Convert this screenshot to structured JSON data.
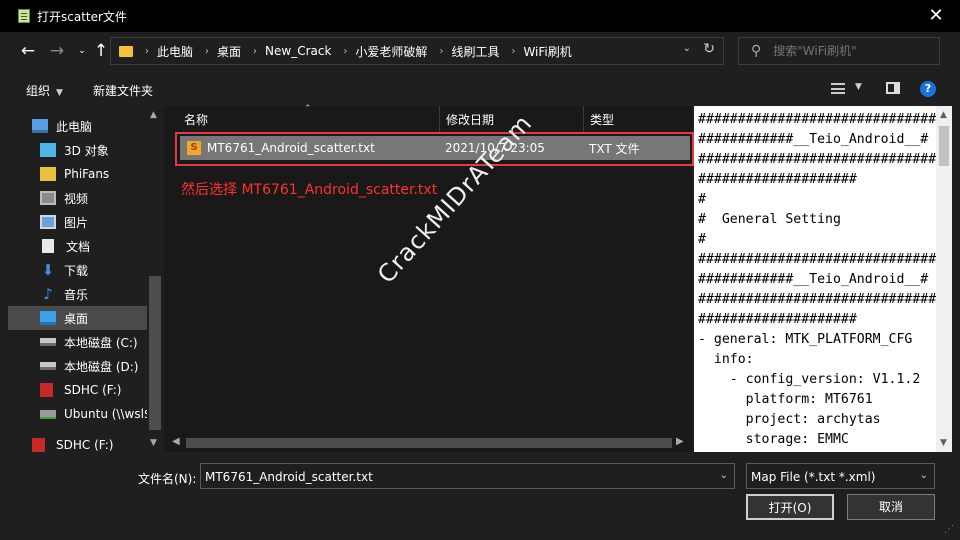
{
  "window": {
    "title": "打开scatter文件"
  },
  "nav": {
    "breadcrumbs": [
      "此电脑",
      "桌面",
      "New_Crack",
      "小爱老师破解",
      "线刷工具",
      "WiFi刷机"
    ],
    "search_placeholder": "搜索\"WiFi刷机\""
  },
  "toolbar": {
    "organize": "组织",
    "new_folder": "新建文件夹"
  },
  "sidebar": {
    "items": [
      {
        "label": "此电脑",
        "icon": "pc-icon"
      },
      {
        "label": "3D 对象",
        "icon": "3d-objects-icon"
      },
      {
        "label": "PhiFans",
        "icon": "phifans-icon"
      },
      {
        "label": "视频",
        "icon": "video-icon"
      },
      {
        "label": "图片",
        "icon": "pictures-icon"
      },
      {
        "label": "文档",
        "icon": "documents-icon"
      },
      {
        "label": "下载",
        "icon": "download-icon"
      },
      {
        "label": "音乐",
        "icon": "music-icon"
      },
      {
        "label": "桌面",
        "icon": "desktop-icon",
        "selected": true
      },
      {
        "label": "本地磁盘 (C:)",
        "icon": "drive-icon"
      },
      {
        "label": "本地磁盘 (D:)",
        "icon": "drive-icon"
      },
      {
        "label": "SDHC (F:)",
        "icon": "sd-card-icon"
      },
      {
        "label": "Ubuntu (\\\\wsl$)",
        "icon": "network-drive-icon"
      },
      {
        "label": "SDHC (F:)",
        "icon": "sd-card-icon"
      }
    ]
  },
  "filelist": {
    "columns": [
      "名称",
      "修改日期",
      "类型"
    ],
    "files": [
      {
        "name": "MT6761_Android_scatter.txt",
        "date": "2021/10/7 23:05",
        "type": "TXT 文件"
      }
    ],
    "annotation": "然后选择 MT6761_Android_scatter.txt"
  },
  "preview": {
    "lines": [
      "##############################",
      "############__Teio_Android__#",
      "##############################",
      "####################",
      "#",
      "#  General Setting",
      "#",
      "##############################",
      "############__Teio_Android__#",
      "##############################",
      "####################",
      "- general: MTK_PLATFORM_CFG",
      "  info:",
      "    - config_version: V1.1.2",
      "      platform: MT6761",
      "      project: archytas",
      "      storage: EMMC"
    ]
  },
  "bottom": {
    "filename_label": "文件名(N):",
    "filename_value": "MT6761_Android_scatter.txt",
    "filter_value": "Map File (*.txt *.xml)",
    "open_label": "打开(O)",
    "cancel_label": "取消"
  },
  "watermark": "CrackMIDrATeam"
}
